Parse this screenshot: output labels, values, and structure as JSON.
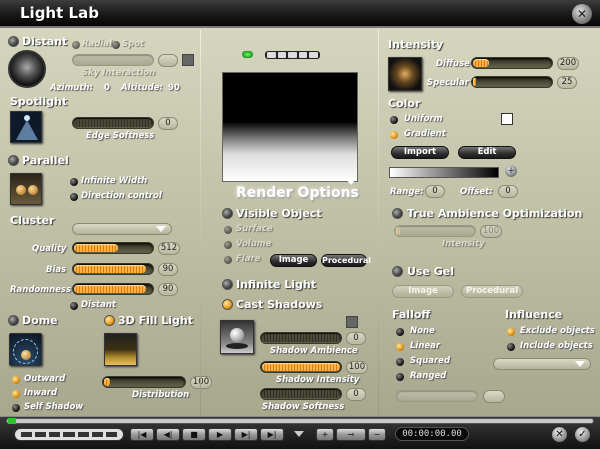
{
  "window": {
    "title": "Light Lab"
  },
  "distant": {
    "label": "Distant",
    "radial": "Radial",
    "spot": "Spot",
    "sky_interaction": "Sky Interaction",
    "azimuth_label": "Azimuth:",
    "azimuth": "0",
    "altitude_label": "Altitude:",
    "altitude": "90"
  },
  "spotlight": {
    "label": "Spotlight",
    "edge_softness_label": "Edge Softness",
    "edge_softness": "0"
  },
  "parallel": {
    "label": "Parallel",
    "infinite_width": "Infinite Width",
    "direction_control": "Direction control"
  },
  "cluster": {
    "label": "Cluster",
    "quality_label": "Quality",
    "quality": "512",
    "quality_level": 0.55,
    "bias_label": "Bias",
    "bias": "90",
    "bias_level": 0.9,
    "randomness_label": "Randomness",
    "randomness": "90",
    "randomness_level": 0.9,
    "distant": "Distant"
  },
  "dome": {
    "label": "Dome",
    "outward": "Outward",
    "inward": "Inward",
    "self_shadow": "Self Shadow"
  },
  "fill3d": {
    "label": "3D Fill Light",
    "distribution_label": "Distribution",
    "distribution": "100"
  },
  "render": {
    "title": "Render Options",
    "visible_object": "Visible Object",
    "surface": "Surface",
    "volume": "Volume",
    "flare": "Flare",
    "image_btn": "Image",
    "procedural_btn": "Procedural",
    "infinite_light": "Infinite Light",
    "cast_shadows": "Cast Shadows",
    "shadow_ambience_label": "Shadow Ambience",
    "shadow_ambience": "0",
    "shadow_intensity_label": "Shadow Intensity",
    "shadow_intensity": "100",
    "shadow_softness_label": "Shadow Softness",
    "shadow_softness": "0"
  },
  "intensity": {
    "label": "Intensity",
    "diffuse_label": "Diffuse",
    "diffuse": "200",
    "specular_label": "Specular",
    "specular": "25"
  },
  "color": {
    "label": "Color",
    "uniform": "Uniform",
    "gradient": "Gradient",
    "import_btn": "Import",
    "edit_btn": "Edit",
    "range_label": "Range:",
    "range": "0",
    "offset_label": "Offset:",
    "offset": "0"
  },
  "tao": {
    "label": "True Ambience Optimization",
    "intensity_label": "Intensity",
    "intensity": "100"
  },
  "gel": {
    "label": "Use Gel",
    "image_btn": "Image",
    "procedural_btn": "Procedural"
  },
  "falloff": {
    "label": "Falloff",
    "none": "None",
    "linear": "Linear",
    "squared": "Squared",
    "ranged": "Ranged"
  },
  "influence": {
    "label": "Influence",
    "exclude": "Exclude objects",
    "include": "Include objects"
  },
  "transport": {
    "time": "00:00:00.00",
    "first": "|◀",
    "prev_key": "◀|",
    "stop": "■",
    "play": "▶",
    "next_frame": "▶|",
    "next_key": "▶|",
    "last": "▶|",
    "add": "+",
    "key": "⊸",
    "remove": "−",
    "cancel": "✕",
    "ok": "✓"
  },
  "colors": {
    "accent": "#f0a020",
    "title_bg": "#1c1c1c",
    "panel": "#cfcfb6"
  }
}
